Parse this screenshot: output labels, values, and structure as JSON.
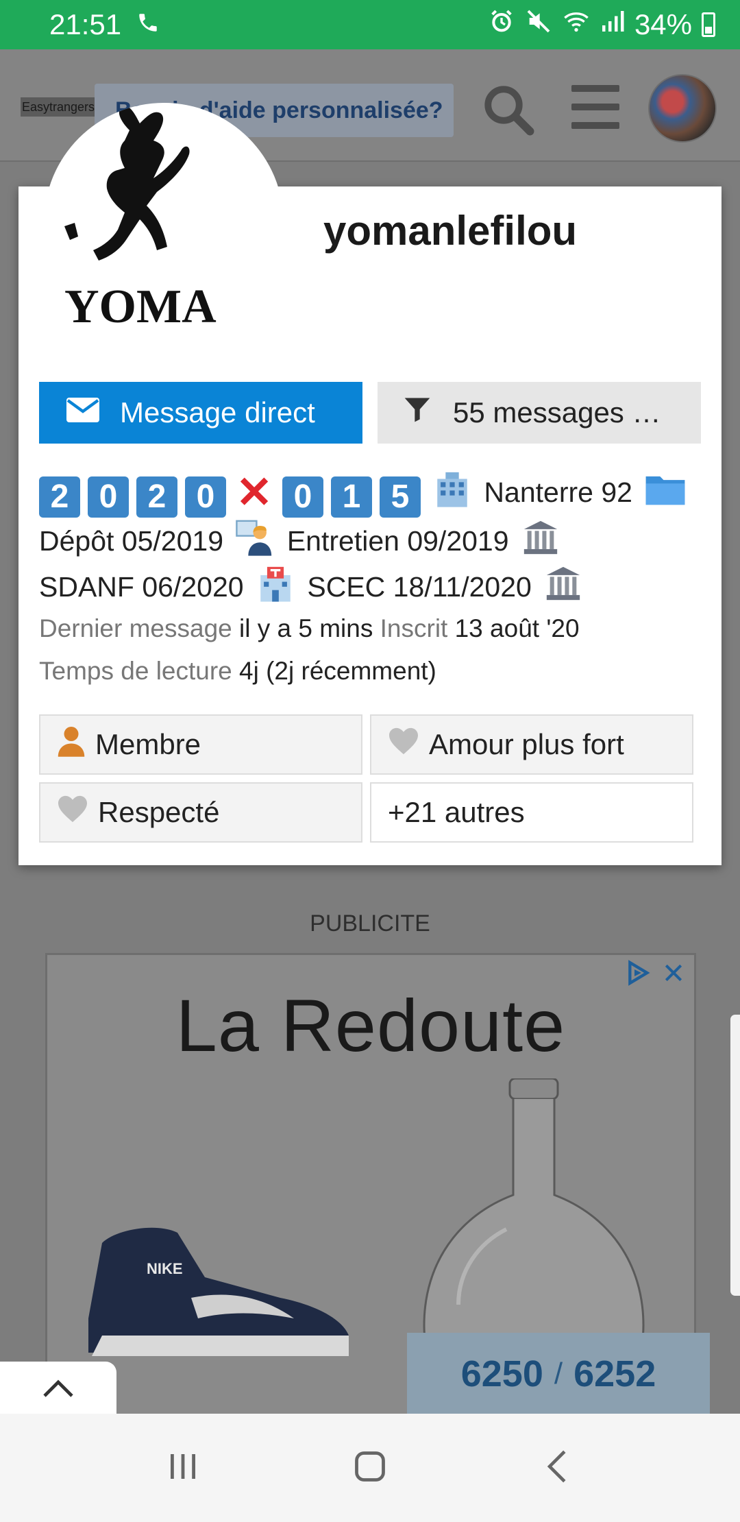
{
  "status_bar": {
    "time": "21:51",
    "battery": "34%",
    "icons": [
      "phone-icon",
      "alarm-icon",
      "mute-icon",
      "wifi-icon",
      "signal-icon",
      "battery-icon"
    ]
  },
  "header": {
    "logo_text": "Easytrangers",
    "help_text": "Besoin d'aide personnalisée?",
    "icons": [
      "search-icon",
      "menu-icon",
      "avatar"
    ]
  },
  "user_card": {
    "username": "yomanlefilou",
    "avatar_text": "YOMA",
    "message_button": "Message direct",
    "posts_button": "55 messages …",
    "bio": {
      "digits_a": [
        "2",
        "0",
        "2",
        "0"
      ],
      "digits_b": [
        "0",
        "1",
        "5"
      ],
      "city": "Nanterre 92",
      "depot": "Dépôt 05/2019",
      "entretien": "Entretien 09/2019",
      "sdanf": "SDANF 06/2020",
      "scec": "SCEC 18/11/2020"
    },
    "meta": {
      "last_post_label": "Dernier message",
      "last_post_value": "il y a 5 mins",
      "joined_label": "Inscrit",
      "joined_value": "13 août '20",
      "read_time_label": "Temps de lecture",
      "read_time_value": "4j (2j récemment)"
    },
    "badges": [
      {
        "label": "Membre",
        "icon": "user-icon"
      },
      {
        "label": "Amour plus fort",
        "icon": "heart-icon"
      },
      {
        "label": "Respecté",
        "icon": "heart-icon"
      },
      {
        "label": "+21 autres",
        "icon": ""
      }
    ]
  },
  "ad": {
    "label": "PUBLICITE",
    "brand": "La Redoute",
    "shoe_text": "NIKE"
  },
  "progress": {
    "current": "6250",
    "separator": "/",
    "total": "6252"
  },
  "colors": {
    "status_green": "#1faa59",
    "primary_blue": "#0a84d6",
    "progress_blue": "#1d4e7a"
  }
}
